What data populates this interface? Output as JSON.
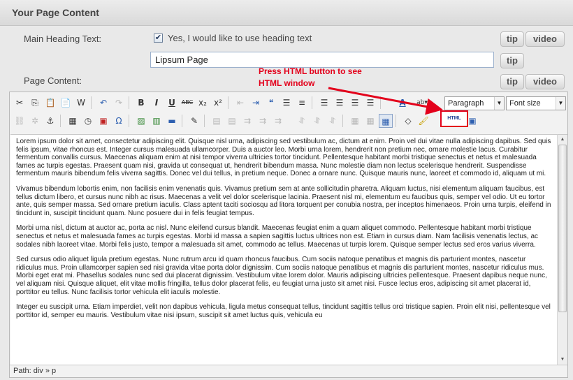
{
  "panel": {
    "title": "Your Page Content"
  },
  "heading": {
    "label": "Main Heading Text:",
    "checkbox_checked": true,
    "checkbox_label": "Yes, I would like to use heading text",
    "title_value": "Lipsum Page"
  },
  "page_content": {
    "label": "Page Content:"
  },
  "buttons": {
    "tip": "tip",
    "video": "video"
  },
  "annotation": {
    "line1": "Press HTML button to see",
    "line2": "HTML window",
    "color": "#e3001b"
  },
  "toolbar": {
    "format_select": "Paragraph",
    "fontsize_select": "Font size",
    "html_label": "HTML",
    "row1_icons": [
      "cut-icon",
      "copy-icon",
      "paste-icon",
      "paste-text-icon",
      "paste-word-icon",
      "undo-icon",
      "redo-icon",
      "bold-icon",
      "italic-icon",
      "underline-icon",
      "strikethrough-icon",
      "superscript-icon",
      "numbered-list-icon",
      "outdent-icon",
      "indent-icon",
      "blockquote-icon",
      "bullet-list-icon",
      "numbered-list-alt-icon",
      "align-left-icon",
      "align-center-icon",
      "align-right-icon",
      "align-justify-icon",
      "text-color-icon",
      "background-color-icon"
    ],
    "row2_icons": [
      "link-icon",
      "unlink-icon",
      "anchor-icon",
      "image-icon",
      "insert-time-icon",
      "media-icon",
      "special-char-icon",
      "template-icon",
      "page-break-icon",
      "horizontal-rule-icon",
      "edit-icon",
      "table-icon",
      "cleanup-icon",
      "html-icon",
      "fullscreen-icon"
    ]
  },
  "content": {
    "paragraphs": [
      "Lorem ipsum dolor sit amet, consectetur adipiscing elit. Quisque nisl urna, adipiscing sed vestibulum ac, dictum at enim. Proin vel dui vitae nulla adipiscing dapibus. Sed quis felis ipsum, vitae rhoncus est. Integer cursus malesuada ullamcorper. Duis a auctor leo. Morbi urna lorem, hendrerit non pretium nec, ornare molestie lacus. Curabitur fermentum convallis cursus. Maecenas aliquam enim at nisi tempor viverra ultricies tortor tincidunt. Pellentesque habitant morbi tristique senectus et netus et malesuada fames ac turpis egestas. Praesent quam nisi, gravida ut consequat ut, hendrerit bibendum massa. Nunc molestie diam non lectus scelerisque hendrerit. Suspendisse fermentum mauris bibendum felis viverra sagittis. Donec vel dui tellus, in pretium neque. Donec a ornare nunc. Quisque mauris nunc, laoreet et commodo id, aliquam ut mi.",
      "Vivamus bibendum lobortis enim, non facilisis enim venenatis quis. Vivamus pretium sem at ante sollicitudin pharetra. Aliquam luctus, nisi elementum aliquam faucibus, est tellus dictum libero, et cursus nunc nibh ac risus. Maecenas a velit vel dolor scelerisque lacinia. Praesent nisl mi, elementum eu faucibus quis, semper vel odio. Ut eu tortor ante, quis semper massa. Sed ornare pretium iaculis. Class aptent taciti sociosqu ad litora torquent per conubia nostra, per inceptos himenaeos. Proin urna turpis, eleifend in tincidunt in, suscipit tincidunt quam. Nunc posuere dui in felis feugiat tempus.",
      "Morbi urna nisl, dictum at auctor ac, porta ac nisl. Nunc eleifend cursus blandit. Maecenas feugiat enim a quam aliquet commodo. Pellentesque habitant morbi tristique senectus et netus et malesuada fames ac turpis egestas. Morbi id massa a sapien sagittis luctus ultrices non est. Etiam in cursus diam. Nam facilisis venenatis lectus, ac sodales nibh laoreet vitae. Morbi felis justo, tempor a malesuada sit amet, commodo ac tellus. Maecenas ut turpis lorem. Quisque semper lectus sed eros varius viverra.",
      "Sed cursus odio aliquet ligula pretium egestas. Nunc rutrum arcu id quam rhoncus faucibus. Cum sociis natoque penatibus et magnis dis parturient montes, nascetur ridiculus mus. Proin ullamcorper sapien sed nisi gravida vitae porta dolor dignissim. Cum sociis natoque penatibus et magnis dis parturient montes, nascetur ridiculus mus. Morbi eget erat mi. Phasellus sodales nunc sed dui placerat dignissim. Vestibulum vitae lorem dolor. Mauris adipiscing ultricies pellentesque. Praesent dapibus neque nunc, vel aliquam nisi. Quisque aliquet, elit vitae mollis fringilla, tellus dolor placerat felis, eu feugiat urna justo sit amet nisi. Fusce lectus eros, adipiscing sit amet placerat id, porttitor eu tellus. Nunc facilisis tortor vehicula elit iaculis molestie.",
      "Integer eu suscipit urna. Etiam imperdiet, velit non dapibus vehicula, ligula metus consequat tellus, tincidunt sagittis tellus orci tristique sapien. Proin elit nisi, pellentesque vel porttitor id, semper eu mauris. Vestibulum vitae nisi ipsum, suscipit sit amet luctus quis, vehicula eu"
    ]
  },
  "status": {
    "path": "Path: div » p"
  }
}
